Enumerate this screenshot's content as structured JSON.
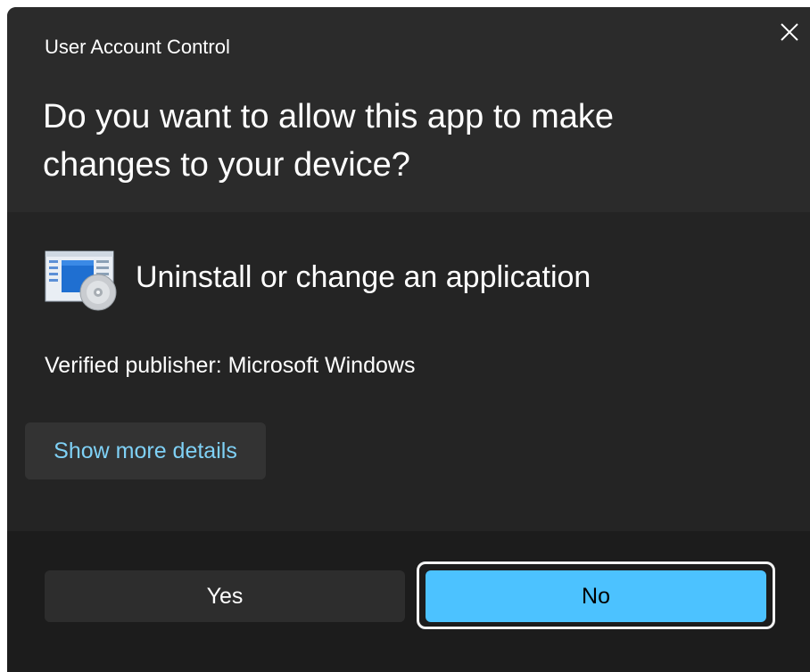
{
  "dialog": {
    "title": "User Account Control",
    "question": "Do you want to allow this app to make changes to your device?",
    "app_icon": "control-panel-programs-icon",
    "app_name": "Uninstall or change an application",
    "publisher": "Verified publisher: Microsoft Windows",
    "details_label": "Show more details",
    "yes_label": "Yes",
    "no_label": "No",
    "close_icon": "close-icon"
  },
  "colors": {
    "background": "#2b2b2b",
    "body_background": "#242424",
    "footer_background": "#1c1c1c",
    "accent": "#4cc2ff",
    "link": "#7fd1f6"
  }
}
